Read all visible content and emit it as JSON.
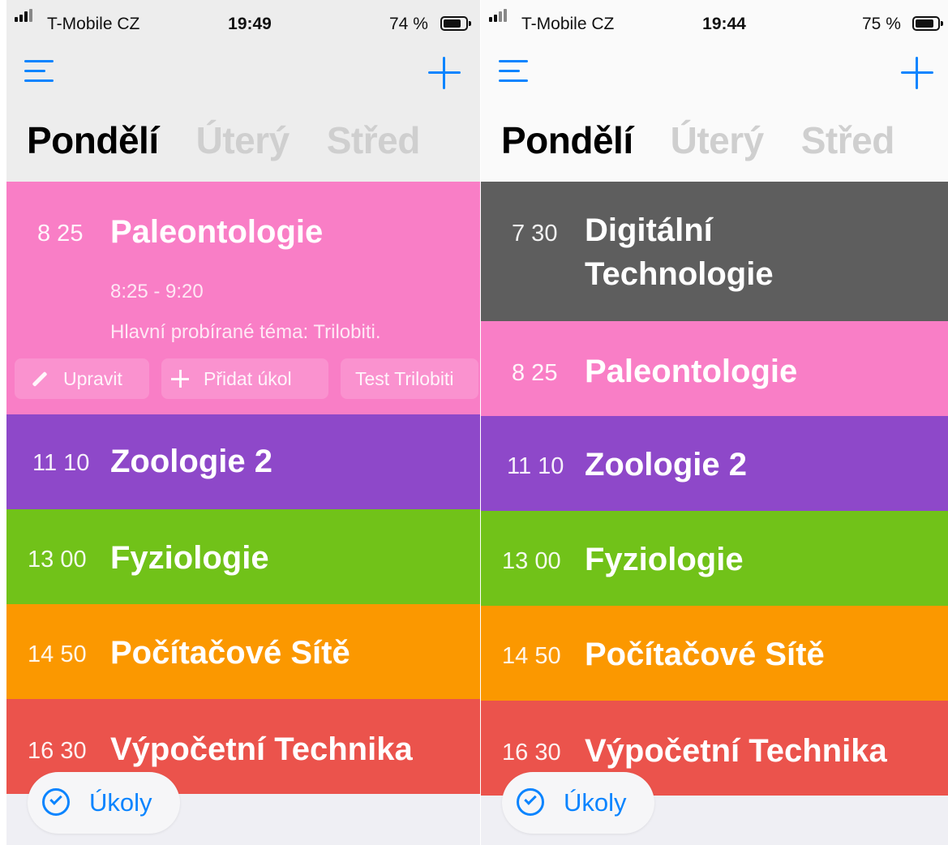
{
  "colors": {
    "accent": "#0a84ff",
    "pink": "#f97ec6",
    "purple": "#8e48c9",
    "green": "#71c219",
    "orange": "#fb9800",
    "red": "#eb534c",
    "gray": "#5e5e5e"
  },
  "left": {
    "status": {
      "carrier": "T-Mobile CZ",
      "time": "19:49",
      "battery": "74 %",
      "battery_level": 0.74
    },
    "days": {
      "active": "Pondělí",
      "next": "Úterý",
      "next2": "Střed"
    },
    "classes": [
      {
        "time": "8 25",
        "title": "Paleontologie"
      },
      {
        "time": "11 10",
        "title": "Zoologie 2"
      },
      {
        "time": "13 00",
        "title": "Fyziologie"
      },
      {
        "time": "14 50",
        "title": "Počítačové Sítě"
      },
      {
        "time": "16 30",
        "title": "Výpočetní Technika"
      }
    ],
    "expanded": {
      "time_range": "8:25 - 9:20",
      "note": "Hlavní probírané téma: Trilobiti.",
      "edit_label": "Upravit",
      "add_task_label": "Přidat úkol",
      "task_chip": "Test Trilobiti"
    },
    "tasks_label": "Úkoly"
  },
  "right": {
    "status": {
      "carrier": "T-Mobile CZ",
      "time": "19:44",
      "battery": "75 %",
      "battery_level": 0.75
    },
    "days": {
      "active": "Pondělí",
      "next": "Úterý",
      "next2": "Střed"
    },
    "classes": [
      {
        "time": "7 30",
        "title_line1": "Digitální",
        "title_line2": "Technologie"
      },
      {
        "time": "8 25",
        "title": "Paleontologie"
      },
      {
        "time": "11 10",
        "title": "Zoologie 2"
      },
      {
        "time": "13 00",
        "title": "Fyziologie"
      },
      {
        "time": "14 50",
        "title": "Počítačové Sítě"
      },
      {
        "time": "16 30",
        "title": "Výpočetní Technika"
      }
    ],
    "tasks_label": "Úkoly"
  }
}
